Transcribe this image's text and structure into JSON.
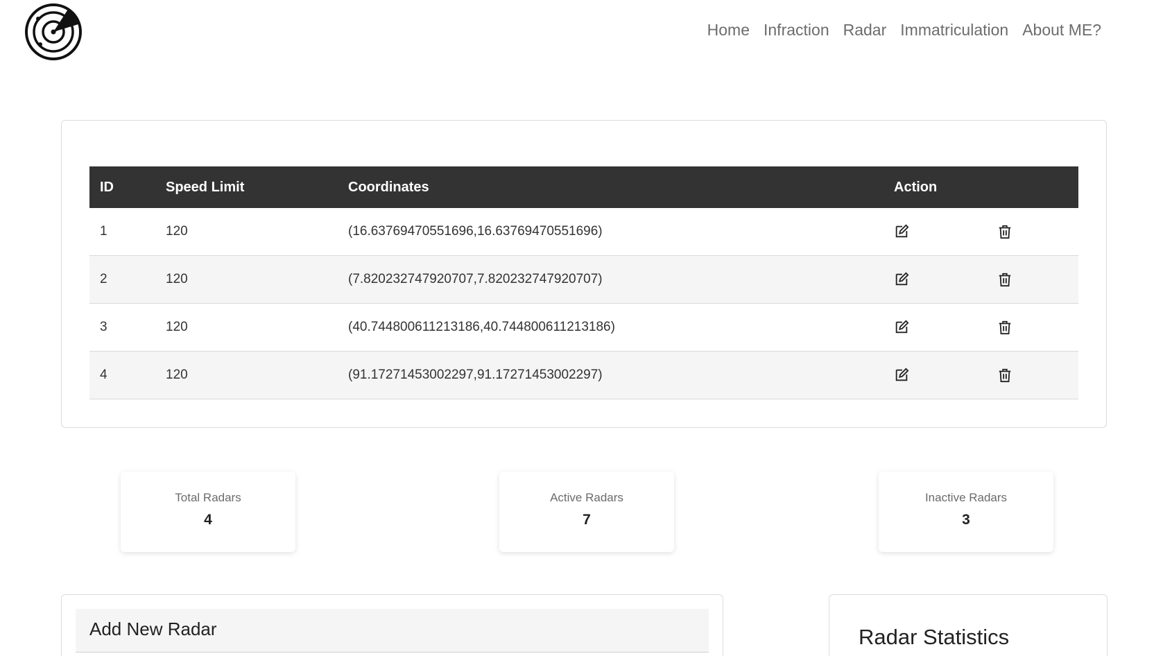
{
  "nav": {
    "items": [
      {
        "label": "Home"
      },
      {
        "label": "Infraction"
      },
      {
        "label": "Radar"
      },
      {
        "label": "Immatriculation"
      },
      {
        "label": "About ME?"
      }
    ]
  },
  "table": {
    "headers": {
      "id": "ID",
      "speed_limit": "Speed Limit",
      "coordinates": "Coordinates",
      "action": "Action"
    },
    "rows": [
      {
        "id": "1",
        "speed_limit": "120",
        "coordinates": "(16.63769470551696,16.63769470551696)"
      },
      {
        "id": "2",
        "speed_limit": "120",
        "coordinates": "(7.820232747920707,7.820232747920707)"
      },
      {
        "id": "3",
        "speed_limit": "120",
        "coordinates": "(40.744800611213186,40.744800611213186)"
      },
      {
        "id": "4",
        "speed_limit": "120",
        "coordinates": "(91.17271453002297,91.17271453002297)"
      }
    ]
  },
  "stats": {
    "total": {
      "label": "Total Radars",
      "value": "4"
    },
    "active": {
      "label": "Active Radars",
      "value": "7"
    },
    "inactive": {
      "label": "Inactive Radars",
      "value": "3"
    }
  },
  "add_radar": {
    "title": "Add New Radar"
  },
  "radar_statistics": {
    "title": "Radar Statistics"
  },
  "icons": {
    "logo": "radar-logo-icon",
    "edit": "edit-icon",
    "delete": "trash-icon"
  }
}
